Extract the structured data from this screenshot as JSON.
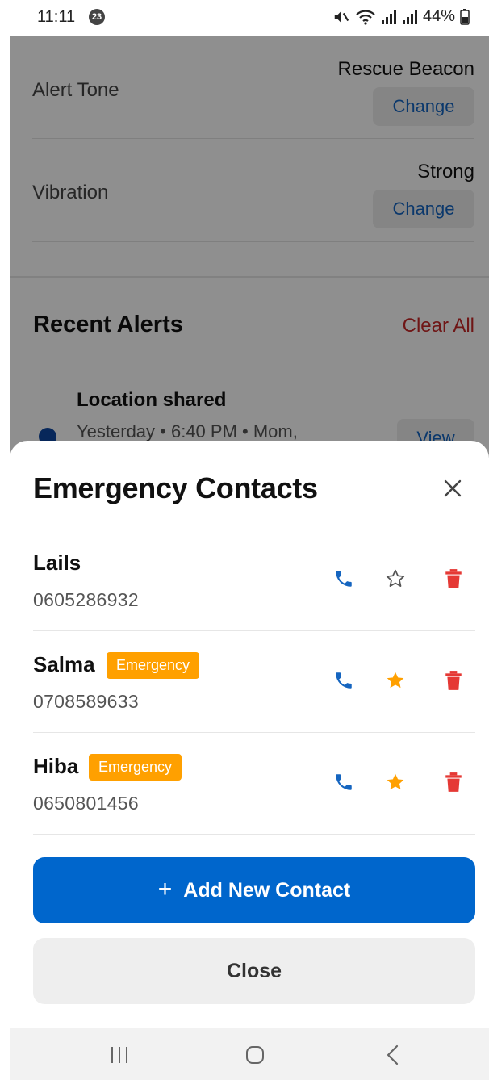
{
  "status_bar": {
    "time": "11:11",
    "notification_count": "23",
    "battery": "44%"
  },
  "background": {
    "settings": [
      {
        "label": "Alert Tone",
        "value": "Rescue Beacon",
        "button": "Change"
      },
      {
        "label": "Vibration",
        "value": "Strong",
        "button": "Change"
      }
    ],
    "recent_alerts": {
      "title": "Recent Alerts",
      "clear_label": "Clear All",
      "items": [
        {
          "title": "Location shared",
          "subtitle": "Yesterday • 6:40 PM • Mom,",
          "button": "View"
        }
      ]
    }
  },
  "sheet": {
    "title": "Emergency Contacts",
    "contacts": [
      {
        "name": "Lails",
        "phone": "0605286932",
        "badge": "",
        "favorite": false
      },
      {
        "name": "Salma",
        "phone": "0708589633",
        "badge": "Emergency",
        "favorite": true
      },
      {
        "name": "Hiba",
        "phone": "0650801456",
        "badge": "Emergency",
        "favorite": true
      }
    ],
    "add_button": "Add New Contact",
    "close_button": "Close"
  },
  "colors": {
    "primary": "#0066cc",
    "danger": "#e53935",
    "badge": "#ffa000",
    "star_active": "#ffa000"
  },
  "icons": {
    "call": "phone-icon",
    "favorite": "star-icon",
    "delete": "trash-icon",
    "close": "close-icon"
  }
}
